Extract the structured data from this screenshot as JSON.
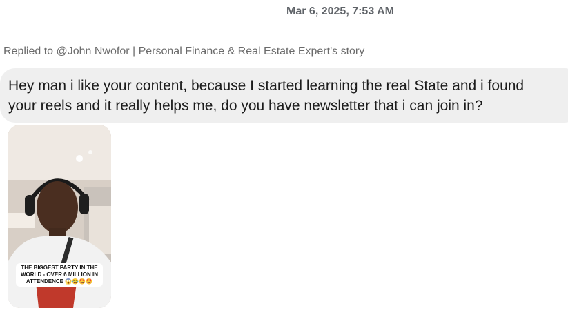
{
  "message": {
    "timestamp": "Mar 6, 2025, 7:53 AM",
    "reply_context": "Replied to @John Nwofor | Personal Finance & Real Estate Expert's story",
    "text_line1": "Hey man i like your content, because I started learning the real State and i found",
    "text_line2": "your reels and it really helps me, do you have newsletter that i can join in?"
  },
  "story": {
    "caption": "THE BIGGEST PARTY IN THE WORLD - OVER 6 MILLION IN ATTENDENCE 😱😂🤩🤩"
  }
}
